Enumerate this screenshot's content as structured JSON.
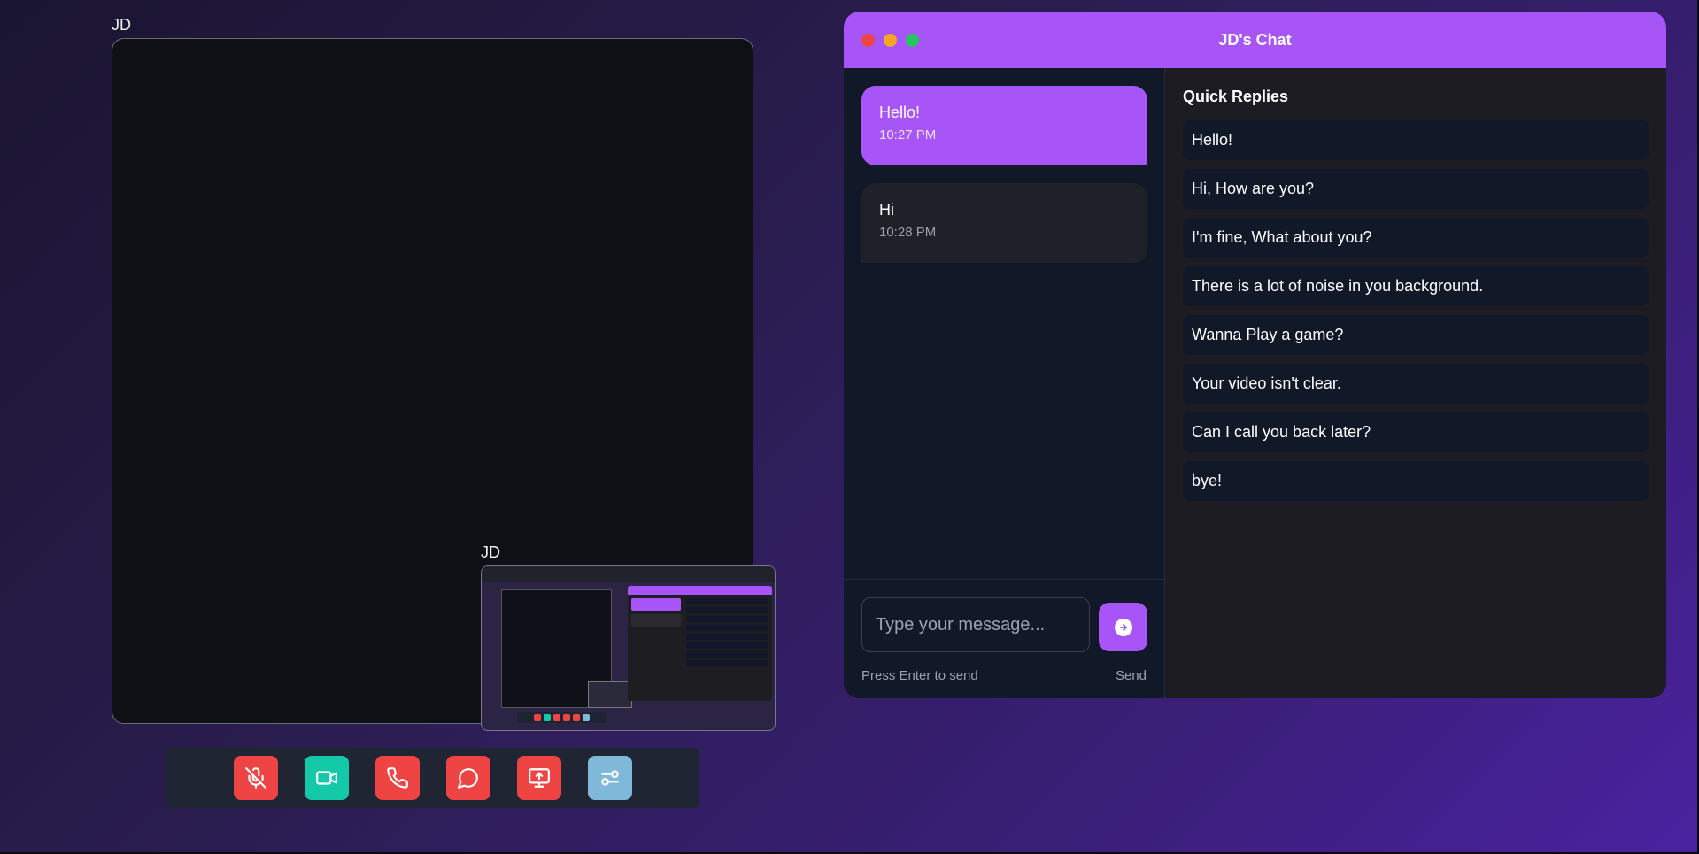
{
  "main_video": {
    "label": "JD"
  },
  "pip_video": {
    "label": "JD"
  },
  "controls": {
    "mic": {
      "icon": "mic-off-icon",
      "color": "#ef4444"
    },
    "camera": {
      "icon": "video-camera-icon",
      "color": "#14c9a7"
    },
    "call": {
      "icon": "phone-icon",
      "color": "#ef4444"
    },
    "chat": {
      "icon": "chat-bubble-icon",
      "color": "#ef4444"
    },
    "screen": {
      "icon": "screen-share-icon",
      "color": "#ef4444"
    },
    "settings": {
      "icon": "sliders-icon",
      "color": "#7fb8d8"
    }
  },
  "chat": {
    "title": "JD's Chat",
    "accent": "#a855f7",
    "messages": [
      {
        "text": "Hello!",
        "time": "10:27 PM",
        "type": "sent"
      },
      {
        "text": "Hi",
        "time": "10:28 PM",
        "type": "received"
      }
    ],
    "input_placeholder": "Type your message...",
    "hint": "Press Enter to send",
    "send_label": "Send",
    "quick_replies_title": "Quick Replies",
    "quick_replies": [
      "Hello!",
      "Hi, How are you?",
      "I'm fine, What about you?",
      "There is a lot of noise in you background.",
      "Wanna Play a game?",
      "Your video isn't clear.",
      "Can I call you back later?",
      "bye!"
    ]
  }
}
